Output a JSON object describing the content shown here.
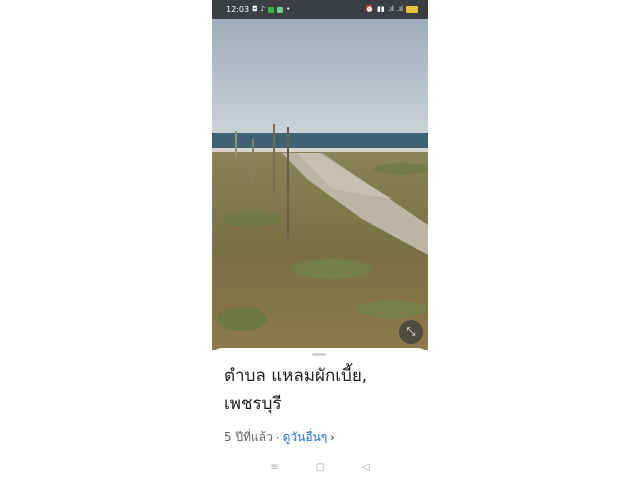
{
  "status_bar": {
    "time": "12:03",
    "left_icons": [
      "camera-icon",
      "tiktok-icon",
      "line-icon",
      "app-icon",
      "dot-icon"
    ],
    "right_icons": [
      "alarm-icon",
      "signal-icon",
      "signal-icon",
      "signal-icon",
      "battery-icon"
    ]
  },
  "photo": {
    "description_icon": "collapse-icon"
  },
  "place": {
    "title": "ตำบล แหลมผักเบี้ย, เพชรบุรี",
    "age": "5 ปีที่แล้ว",
    "separator": "·",
    "more_link": "ดูวันอื่นๆ",
    "chevron": "›"
  },
  "navbar": {
    "menu_glyph": "≡",
    "home_glyph": "▢",
    "back_glyph": "◁"
  },
  "colors": {
    "status_bar_bg": "#3b3f44",
    "link": "#1a73e8",
    "sky": "#a9b8c3",
    "sea": "#3e6173",
    "grass": "#7c7446"
  }
}
